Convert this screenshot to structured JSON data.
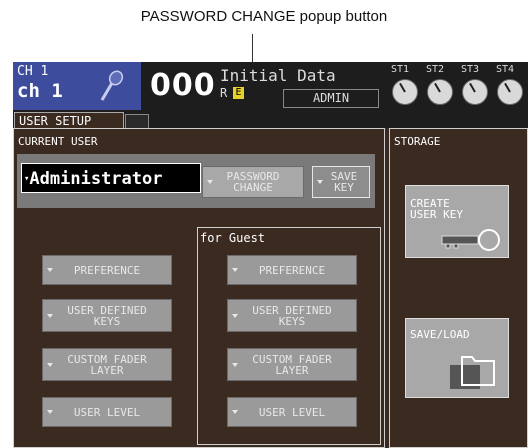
{
  "callout": {
    "text": "PASSWORD CHANGE popup button"
  },
  "topbar": {
    "channel_number": "CH 1",
    "channel_name": "ch 1",
    "scene_number": "000",
    "scene_title": "Initial Data",
    "r_mark": "R",
    "e_mark": "E",
    "user": "ADMIN",
    "st_labels": [
      "ST1",
      "ST2",
      "ST3",
      "ST4"
    ]
  },
  "tabs": {
    "active": "USER SETUP"
  },
  "current_user": {
    "title": "CURRENT USER",
    "user_select": "Administrator",
    "password_change": "PASSWORD\nCHANGE",
    "save_key": "SAVE\nKEY"
  },
  "admin_buttons": {
    "preference": "PREFERENCE",
    "user_defined_keys": "USER DEFINED\nKEYS",
    "custom_fader_layer": "CUSTOM FADER\nLAYER",
    "user_level": "USER LEVEL"
  },
  "guest": {
    "title": "for Guest",
    "preference": "PREFERENCE",
    "user_defined_keys": "USER DEFINED\nKEYS",
    "custom_fader_layer": "CUSTOM FADER\nLAYER",
    "user_level": "USER LEVEL"
  },
  "storage": {
    "title": "STORAGE",
    "create_user_key": "CREATE\nUSER KEY",
    "save_load": "SAVE/LOAD"
  },
  "icons": [
    "mic-icon",
    "knob-icon",
    "dropdown-arrow-icon",
    "key-icon",
    "folder-icon"
  ]
}
